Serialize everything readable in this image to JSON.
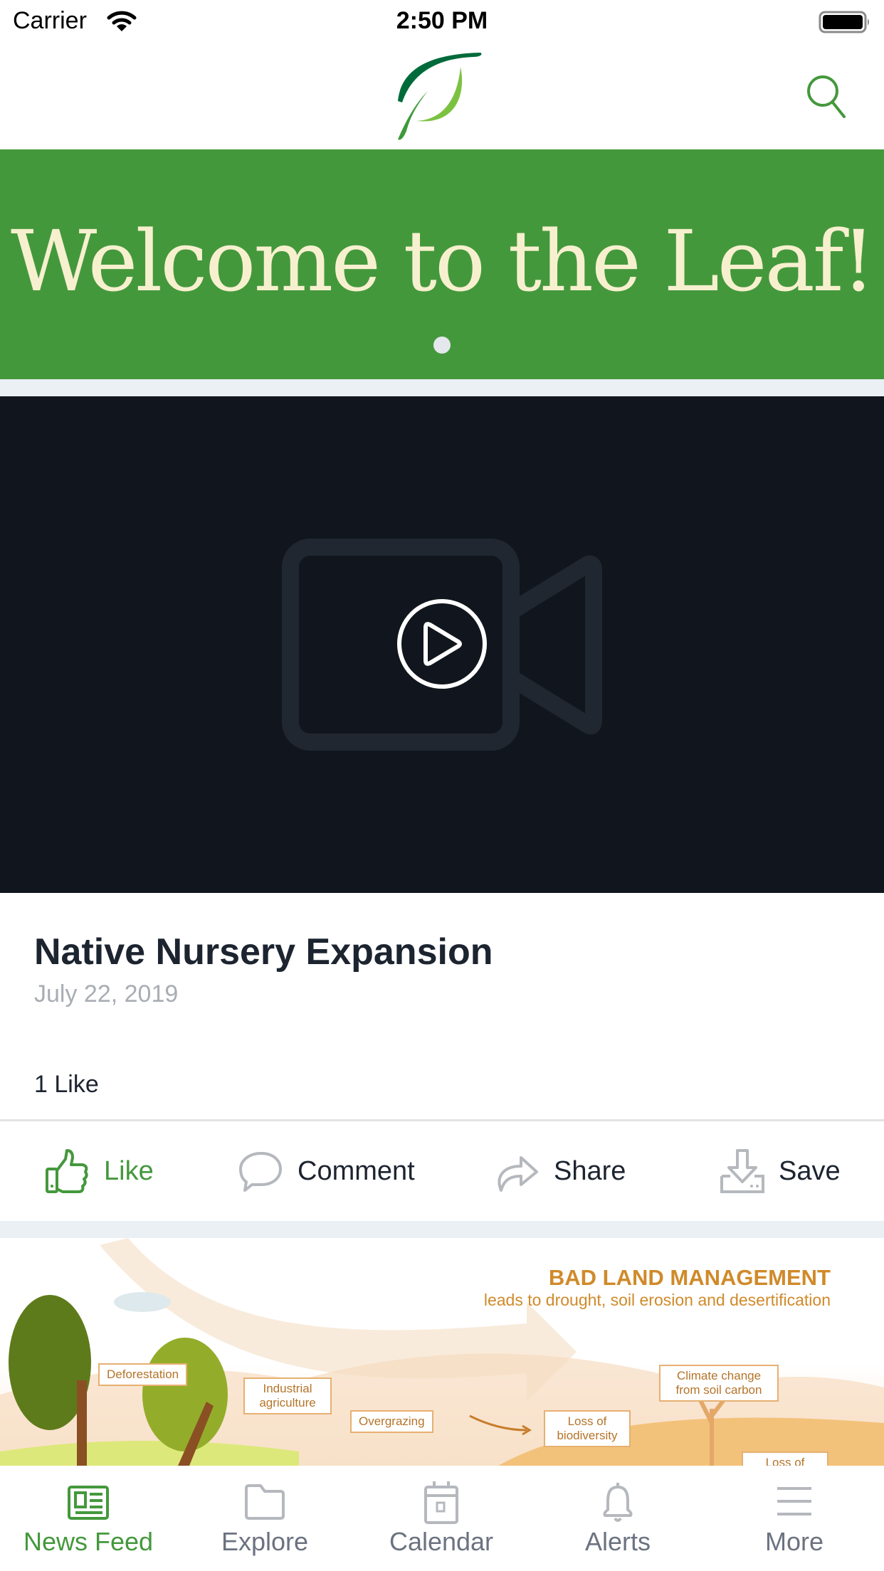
{
  "status_bar": {
    "carrier": "Carrier",
    "time": "2:50 PM",
    "wifi_icon": "wifi-icon",
    "battery_icon": "battery-full-icon"
  },
  "nav_bar": {
    "logo_icon": "leaf-logo",
    "search_icon": "search-icon"
  },
  "banner": {
    "title": "Welcome to the Leaf!",
    "page_count": 1,
    "current_page": 1
  },
  "post": {
    "media_type": "video",
    "title": "Native Nursery Expansion",
    "date": "July 22, 2019",
    "likes_text": "1 Like",
    "liked": true,
    "actions": [
      {
        "label": "Like",
        "icon": "thumbs-up-icon"
      },
      {
        "label": "Comment",
        "icon": "comment-icon"
      },
      {
        "label": "Share",
        "icon": "share-icon"
      },
      {
        "label": "Save",
        "icon": "download-icon"
      }
    ]
  },
  "next_post": {
    "infographic": {
      "title": "BAD LAND MANAGEMENT",
      "subtitle": "leads to drought, soil erosion and desertification",
      "labels": [
        "Deforestation",
        "Industrial agriculture",
        "Overgrazing",
        "Loss of biodiversity",
        "Climate change from soil carbon",
        "Loss of"
      ]
    }
  },
  "colors": {
    "brand_green": "#44983c",
    "banner_text": "#f7f0cf",
    "video_bg": "#11161e",
    "infographic_accent": "#d08a2a"
  },
  "tab_bar": {
    "active": "News Feed",
    "tabs": [
      {
        "label": "News Feed",
        "icon": "newspaper-icon"
      },
      {
        "label": "Explore",
        "icon": "folder-icon"
      },
      {
        "label": "Calendar",
        "icon": "calendar-icon"
      },
      {
        "label": "Alerts",
        "icon": "bell-icon"
      },
      {
        "label": "More",
        "icon": "menu-icon"
      }
    ]
  }
}
